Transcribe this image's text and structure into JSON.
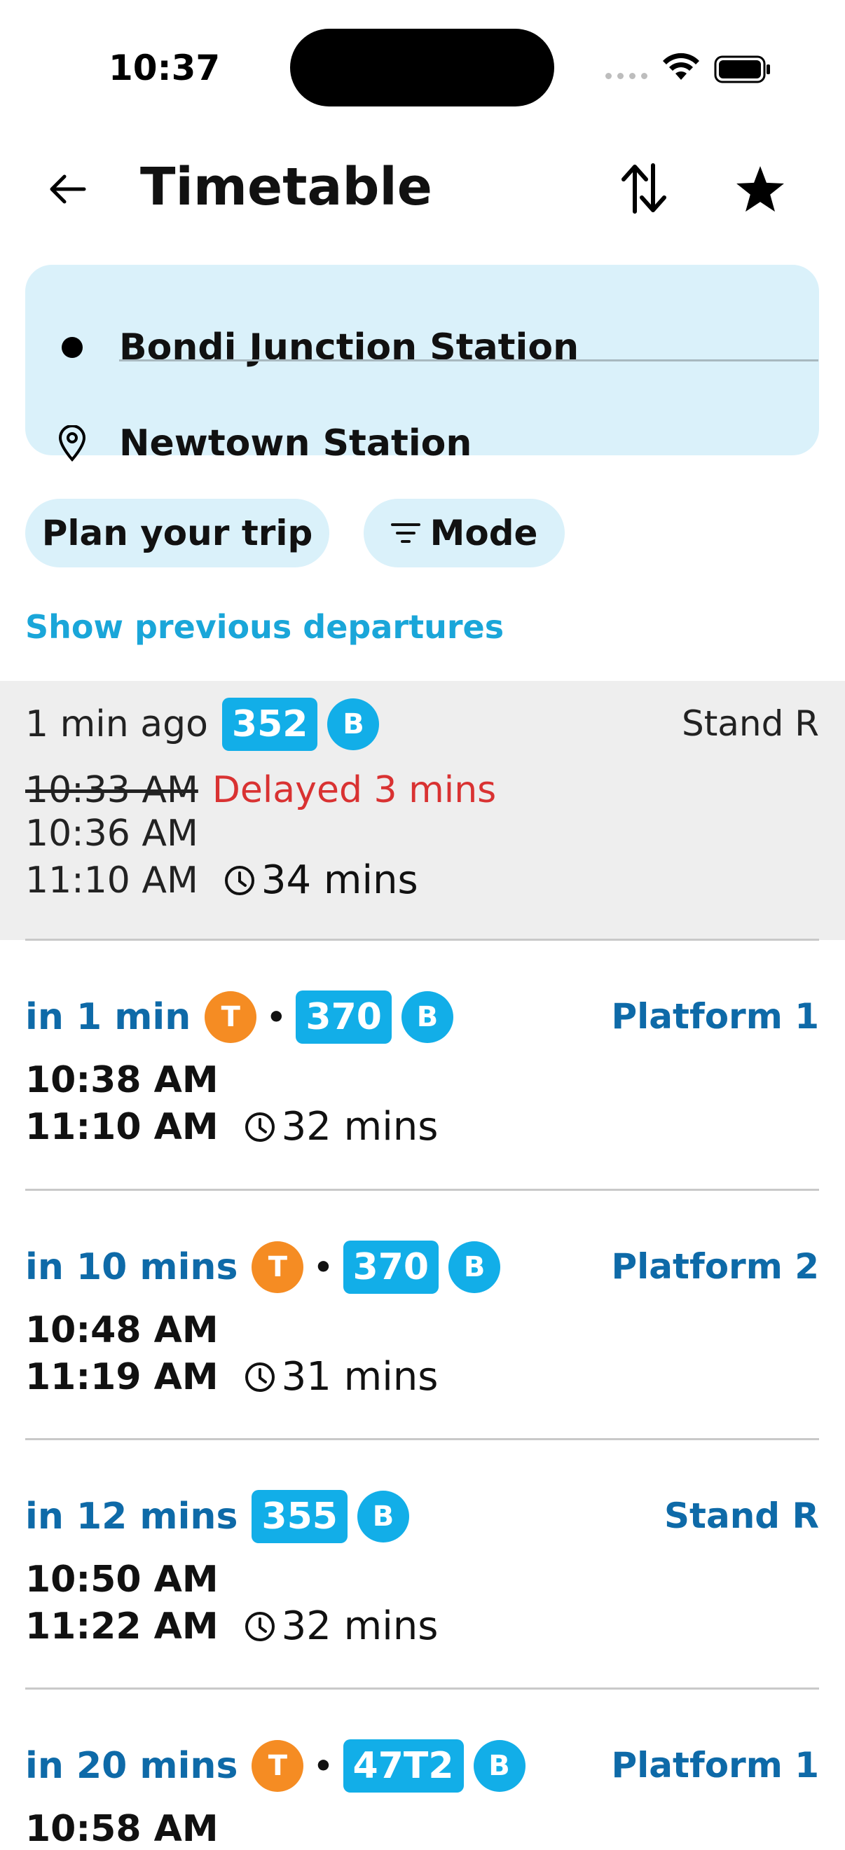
{
  "status_bar": {
    "time": "10:37"
  },
  "header": {
    "title": "Timetable",
    "back_icon": "arrow-left-icon",
    "swap_icon": "swap-vertical-icon",
    "favorite_icon": "star-icon"
  },
  "route": {
    "origin": "Bondi Junction Station",
    "destination": "Newtown Station"
  },
  "chips": {
    "plan": "Plan your trip",
    "mode": "Mode"
  },
  "prev_link": "Show previous departures",
  "colors": {
    "accent": "#12aee8",
    "train": "#f58c23",
    "link": "#1aa6d9",
    "delay": "#d93232",
    "primary_text": "#0e6aa8"
  },
  "departures": [
    {
      "relative": "1 min ago",
      "route": "352",
      "mode": "B",
      "location": "Stand R",
      "scheduled": "10:33 AM",
      "delay": "Delayed 3 mins",
      "departs": "10:36 AM",
      "arrives": "11:10 AM",
      "duration": "34 mins"
    },
    {
      "relative": "in 1 min",
      "train": "T",
      "dot": "•",
      "route": "370",
      "mode": "B",
      "location": "Platform 1",
      "departs": "10:38 AM",
      "arrives": "11:10 AM",
      "duration": "32 mins"
    },
    {
      "relative": "in 10 mins",
      "train": "T",
      "dot": "•",
      "route": "370",
      "mode": "B",
      "location": "Platform 2",
      "departs": "10:48 AM",
      "arrives": "11:19 AM",
      "duration": "31 mins"
    },
    {
      "relative": "in 12 mins",
      "route": "355",
      "mode": "B",
      "location": "Stand R",
      "departs": "10:50 AM",
      "arrives": "11:22 AM",
      "duration": "32 mins"
    },
    {
      "relative": "in 20 mins",
      "train": "T",
      "dot": "•",
      "route": "47T2",
      "mode": "B",
      "location": "Platform 1",
      "departs": "10:58 AM"
    }
  ]
}
